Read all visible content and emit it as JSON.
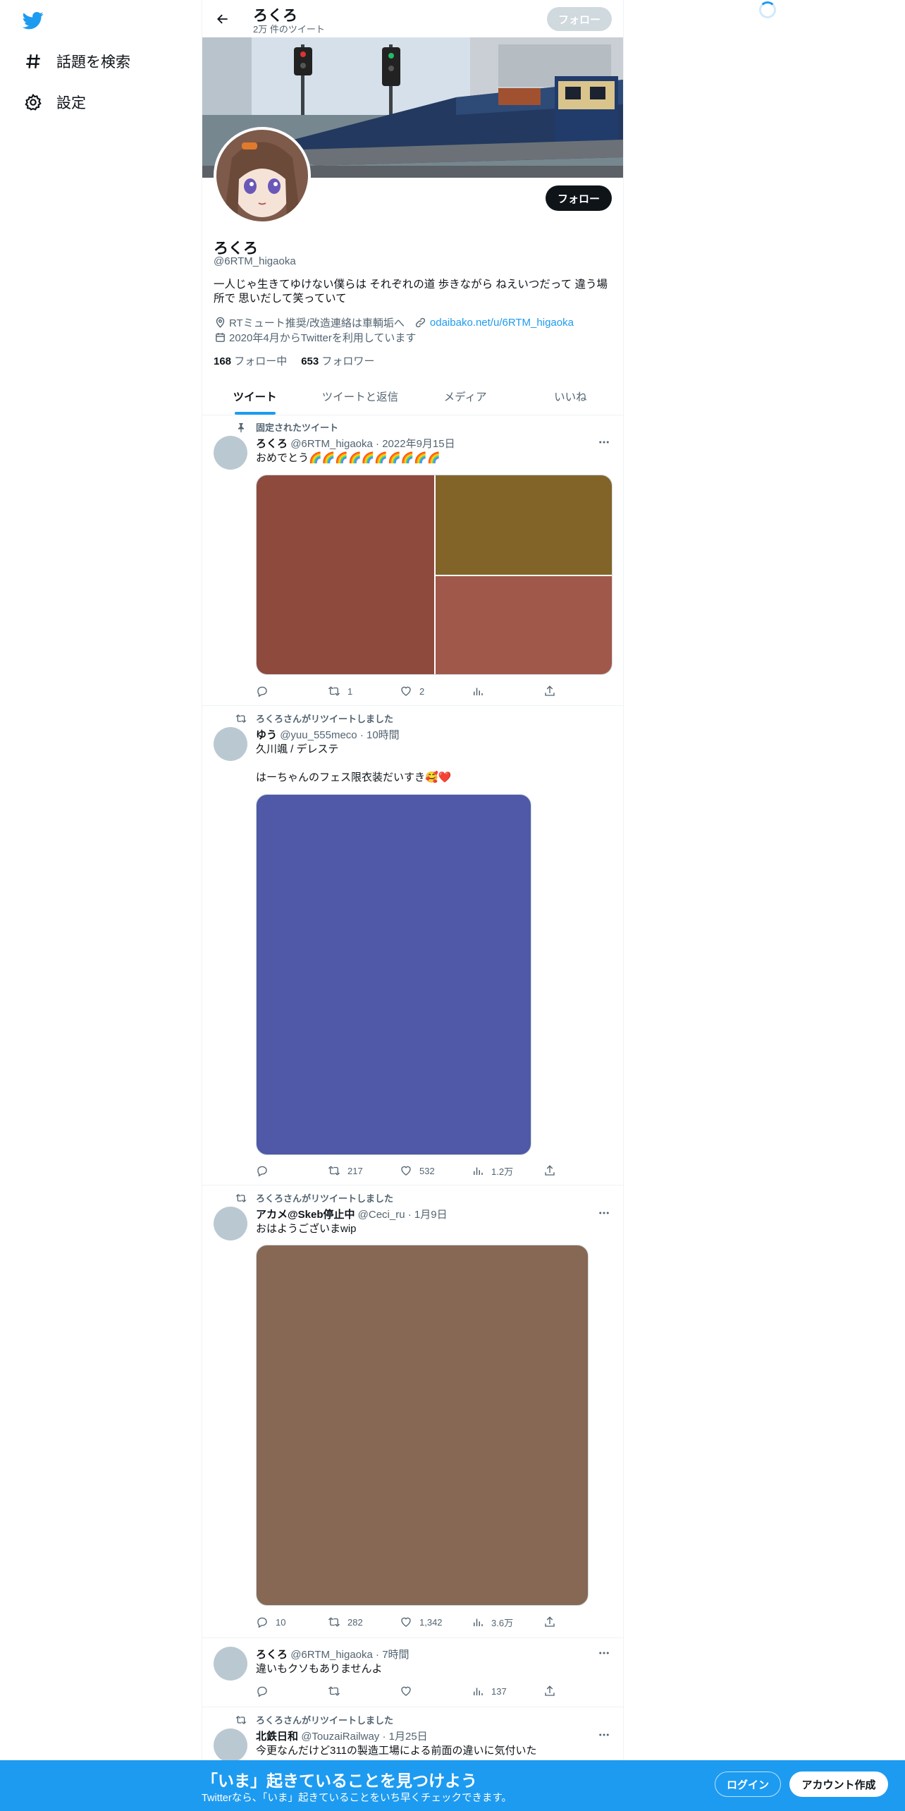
{
  "nav": {
    "logo": "twitter-bird-icon",
    "explore_label": "話題を検索",
    "settings_label": "設定"
  },
  "header": {
    "name": "ろくろ",
    "tweet_count": "2万 件のツイート",
    "follow_label": "フォロー"
  },
  "profile": {
    "name": "ろくろ",
    "handle": "@6RTM_higaoka",
    "follow_label": "フォロー",
    "bio": "一人じゃ生きてゆけない僕らは それぞれの道 歩きながら ねえいつだって 違う場所で 思いだして笑っていて",
    "location": "RTミュート推奨/改造連絡は車輌垢へ",
    "link": "odaibako.net/u/6RTM_higaoka",
    "joined": "2020年4月からTwitterを利用しています",
    "following_count": "168",
    "following_label": "フォロー中",
    "followers_count": "653",
    "followers_label": "フォロワー"
  },
  "tabs": [
    {
      "label": "ツイート"
    },
    {
      "label": "ツイートと返信"
    },
    {
      "label": "メディア"
    },
    {
      "label": "いいね"
    }
  ],
  "tweets": [
    {
      "context": "固定されたツイート",
      "name": "ろくろ",
      "handle": "@6RTM_higaoka",
      "time": "2022年9月15日",
      "text": "おめでとう🌈🌈🌈🌈🌈🌈🌈🌈🌈🌈",
      "media_colors": [
        "#8e4a3d",
        "#826429",
        "#a0584b"
      ],
      "reply": "",
      "retweet": "1",
      "like": "2",
      "views": ""
    },
    {
      "context": "ろくろさんがリツイートしました",
      "name": "ゆう",
      "handle": "@yuu_555meco",
      "time": "10時間",
      "text": "久川颯 / デレステ\n\nはーちゃんのフェス限衣装だいすき🥰❤️",
      "media_colors": [
        "#4f59a8"
      ],
      "reply": "",
      "retweet": "217",
      "like": "532",
      "views": "1.2万"
    },
    {
      "context": "ろくろさんがリツイートしました",
      "name": "アカメ@Skeb停止中",
      "handle": "@Ceci_ru",
      "time": "1月9日",
      "text": "おはようございまwip",
      "media_colors": [
        "#876854"
      ],
      "reply": "10",
      "retweet": "282",
      "like": "1,342",
      "views": "3.6万"
    },
    {
      "context": "",
      "name": "ろくろ",
      "handle": "@6RTM_higaoka",
      "time": "7時間",
      "text": "違いもクソもありませんよ",
      "reply": "",
      "retweet": "",
      "like": "",
      "views": "137"
    },
    {
      "context": "ろくろさんがリツイートしました",
      "name": "北鉄日和",
      "handle": "@TouzaiRailway",
      "time": "1月25日",
      "text": "今更なんだけど311の製造工場による前面の違いに気付いた"
    }
  ],
  "bottom": {
    "title": "「いま」起きていることを見つけよう",
    "subtitle": "Twitterなら、「いま」起きていることをいち早くチェックできます。",
    "login": "ログイン",
    "signup": "アカウント作成"
  }
}
